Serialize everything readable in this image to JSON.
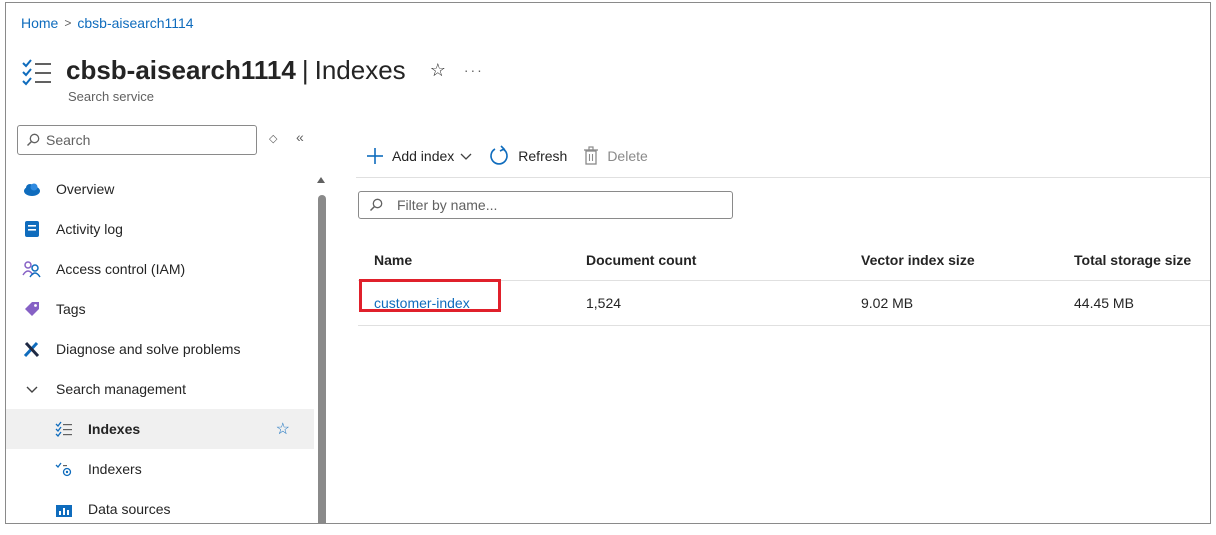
{
  "breadcrumb": {
    "home": "Home",
    "separator": ">",
    "current": "cbsb-aisearch1114"
  },
  "header": {
    "resource_name": "cbsb-aisearch1114",
    "separator": "|",
    "page_name": "Indexes",
    "subtitle": "Search service",
    "favorite_glyph": "☆",
    "more_glyph": "···"
  },
  "sidebar": {
    "search_placeholder": "Search",
    "items": [
      {
        "label": "Overview",
        "icon": "cloud-icon"
      },
      {
        "label": "Activity log",
        "icon": "activity-log-icon"
      },
      {
        "label": "Access control (IAM)",
        "icon": "people-icon"
      },
      {
        "label": "Tags",
        "icon": "tag-icon"
      },
      {
        "label": "Diagnose and solve problems",
        "icon": "wrench-icon"
      },
      {
        "label": "Search management",
        "icon": "chevron-down-icon"
      },
      {
        "label": "Indexes",
        "icon": "indexes-icon",
        "active": true
      },
      {
        "label": "Indexers",
        "icon": "indexers-icon"
      },
      {
        "label": "Data sources",
        "icon": "data-sources-icon"
      }
    ]
  },
  "toolbar": {
    "add_index": "Add index",
    "refresh": "Refresh",
    "delete": "Delete"
  },
  "filter": {
    "placeholder": "Filter by name..."
  },
  "table": {
    "columns": [
      "Name",
      "Document count",
      "Vector index size",
      "Total storage size"
    ],
    "rows": [
      {
        "name": "customer-index",
        "document_count": "1,524",
        "vector_index_size": "9.02 MB",
        "total_storage_size": "44.45 MB"
      }
    ]
  },
  "colors": {
    "link": "#0f6cbd",
    "highlight": "#e0202b",
    "active_bg": "#f0f0f0"
  }
}
